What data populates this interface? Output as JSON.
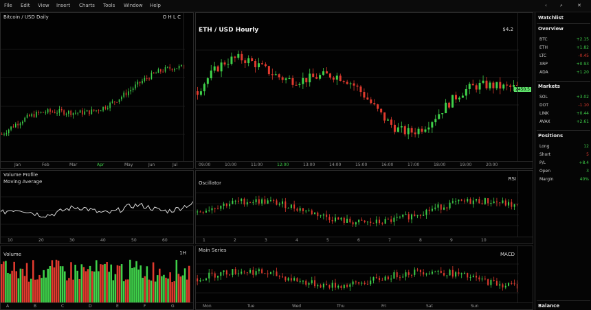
{
  "menubar": {
    "items": [
      "File",
      "Edit",
      "View",
      "Insert",
      "Charts",
      "Tools",
      "Window",
      "Help"
    ],
    "right_icons": [
      "chevron-left-icon",
      "search-icon",
      "close-icon"
    ]
  },
  "panels": {
    "top_left": {
      "title": "Bitcoin / USD Daily",
      "readout": "O H L C",
      "xaxis": [
        "Jan",
        "Feb",
        "Mar",
        "Apr",
        "May",
        "Jun",
        "Jul"
      ],
      "xaxis_highlight": "Apr"
    },
    "top_center": {
      "title": "ETH / USD Hourly",
      "badge": "$4.2",
      "xaxis": [
        "09:00",
        "10:00",
        "11:00",
        "12:00",
        "13:00",
        "14:00",
        "15:00",
        "16:00",
        "17:00",
        "18:00",
        "19:00",
        "20:00"
      ],
      "xaxis_highlight": "12:00",
      "price_tag": "2450.5"
    },
    "mid_left": {
      "title": "Volume Profile",
      "subtitle": "Moving Average",
      "xaxis": [
        "10",
        "20",
        "30",
        "40",
        "50",
        "60"
      ]
    },
    "mid_center": {
      "title": "Oscillator",
      "label": "RSI",
      "xaxis": [
        "1",
        "2",
        "3",
        "4",
        "5",
        "6",
        "7",
        "8",
        "9",
        "10"
      ]
    },
    "bottom_left": {
      "title": "Volume",
      "badge": "1H",
      "xaxis": [
        "A",
        "B",
        "C",
        "D",
        "E",
        "F",
        "G"
      ]
    },
    "bottom_center": {
      "title": "Main Series",
      "label": "MACD",
      "xaxis": [
        "Mon",
        "Tue",
        "Wed",
        "Thu",
        "Fri",
        "Sat",
        "Sun"
      ]
    }
  },
  "sidebar": {
    "header": "Watchlist",
    "sections": [
      {
        "title": "Overview",
        "rows": [
          {
            "label": "BTC",
            "value": "+2.15"
          },
          {
            "label": "ETH",
            "value": "+1.82"
          },
          {
            "label": "LTC",
            "value": "-0.45",
            "neg": true
          },
          {
            "label": "XRP",
            "value": "+0.93"
          },
          {
            "label": "ADA",
            "value": "+1.20"
          }
        ]
      },
      {
        "title": "Markets",
        "rows": [
          {
            "label": "SOL",
            "value": "+3.02"
          },
          {
            "label": "DOT",
            "value": "-1.10",
            "neg": true
          },
          {
            "label": "LINK",
            "value": "+0.44"
          },
          {
            "label": "AVAX",
            "value": "+2.61"
          }
        ]
      },
      {
        "title": "Positions",
        "rows": [
          {
            "label": "Long",
            "value": "12"
          },
          {
            "label": "Short",
            "value": "5",
            "neg": true
          },
          {
            "label": "P/L",
            "value": "+8.4"
          },
          {
            "label": "Open",
            "value": "3"
          },
          {
            "label": "Margin",
            "value": "40%"
          }
        ]
      }
    ],
    "footer": "Balance"
  },
  "colors": {
    "up": "#3fd14a",
    "down": "#e03a2e",
    "background": "#050505",
    "grid": "#161616"
  }
}
